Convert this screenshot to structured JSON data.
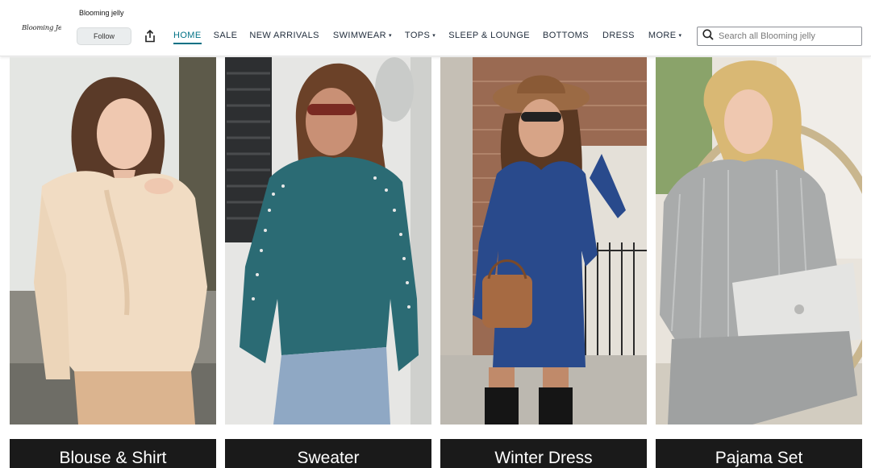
{
  "store": {
    "logo_text": "Blooming Jelly",
    "name": "Blooming jelly",
    "follow_label": "Follow"
  },
  "nav": {
    "items": [
      {
        "label": "HOME",
        "active": true,
        "has_dropdown": false
      },
      {
        "label": "SALE",
        "active": false,
        "has_dropdown": false
      },
      {
        "label": "NEW ARRIVALS",
        "active": false,
        "has_dropdown": false
      },
      {
        "label": "SWIMWEAR",
        "active": false,
        "has_dropdown": true
      },
      {
        "label": "TOPS",
        "active": false,
        "has_dropdown": true
      },
      {
        "label": "SLEEP & LOUNGE",
        "active": false,
        "has_dropdown": false
      },
      {
        "label": "BOTTOMS",
        "active": false,
        "has_dropdown": false
      },
      {
        "label": "DRESS",
        "active": false,
        "has_dropdown": false
      },
      {
        "label": "MORE",
        "active": false,
        "has_dropdown": true
      }
    ]
  },
  "search": {
    "placeholder": "Search all Blooming jelly",
    "value": ""
  },
  "categories": [
    {
      "label": "Blouse & Shirt",
      "image": "woman in beige ruffled blouse"
    },
    {
      "label": "Sweater",
      "image": "woman in teal pearl-embellished sweater"
    },
    {
      "label": "Winter Dress",
      "image": "woman in navy ribbed bodycon dress with hat"
    },
    {
      "label": "Pajama Set",
      "image": "woman in grey ribbed lounge set with laptop"
    }
  ],
  "colors": {
    "accent": "#007185",
    "nav_text": "#232f3e",
    "label_bg": "#1a1a1a"
  }
}
